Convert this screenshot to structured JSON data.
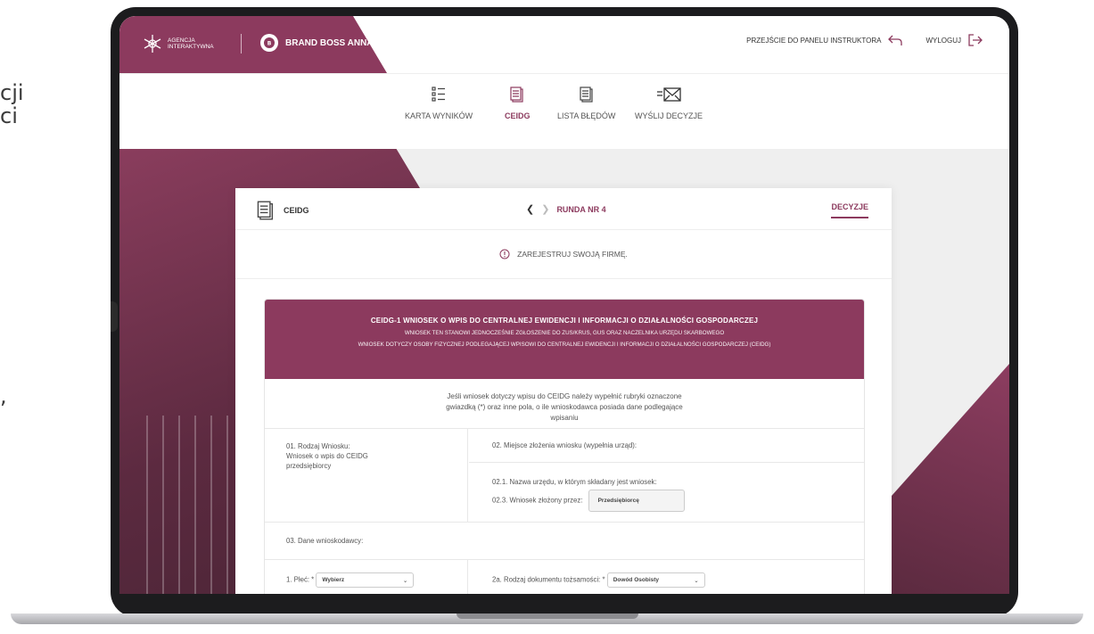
{
  "side_fragments": [
    "cji",
    "ci",
    ","
  ],
  "brand": {
    "agency_line1": "AGENCJA",
    "agency_line2": "INTERAKTYWNA",
    "company": "BRAND BOSS ANNA"
  },
  "header": {
    "instructor_link": "PRZEJŚCIE DO PANELU INSTRUKTORA",
    "logout": "WYLOGUJ"
  },
  "nav": {
    "items": [
      {
        "label": "KARTA WYNIKÓW",
        "icon": "list-icon"
      },
      {
        "label": "CEIDG",
        "icon": "document-icon",
        "active": true
      },
      {
        "label": "LISTA BŁĘDÓW",
        "icon": "documents-icon"
      },
      {
        "label": "WYŚLIJ DECYZJE",
        "icon": "envelope-icon"
      }
    ]
  },
  "card": {
    "title": "CEIDG",
    "round": "RUNDA NR 4",
    "decisions_tab": "DECYZJE",
    "notice": "ZAREJESTRUJ SWOJĄ FIRMĘ."
  },
  "form": {
    "title": "CEIDG-1 WNIOSEK O WPIS DO CENTRALNEJ EWIDENCJI I INFORMACJI O DZIAŁALNOŚCI GOSPODARCZEJ",
    "subtitle1": "WNIOSEK TEN STANOWI JEDNOCZEŚNIE ZGŁOSZENIE DO ZUS/KRUS, GUS ORAZ NACZELNIKA URZĘDU SKARBOWEGO",
    "subtitle2": "WNIOSEK DOTYCZY OSOBY FIZYCZNEJ PODLEGAJĄCEJ WPISOWI DO CENTRALNEJ EWIDENCJI I INFORMACJI O DZIAŁALNOŚCI GOSPODARCZEJ (CEIDG)",
    "intro_line1": "Jeśli wniosek dotyczy wpisu do CEIDG należy wypełnić rubryki oznaczone",
    "intro_line2": "gwiazdką (*) oraz inne pola, o ile wnioskodawca posiada dane podlegające",
    "intro_line3": "wpisaniu",
    "field01_label": "01. Rodzaj Wniosku:",
    "field01_value_line1": "Wniosek o wpis do CEIDG",
    "field01_value_line2": "przedsiębiorcy",
    "field02_label": "02. Miejsce złożenia wniosku (wypełnia urząd):",
    "field021_label": "02.1. Nazwa urzędu, w którym składany jest wniosek:",
    "field023_label": "02.3. Wniosek złożony przez:",
    "field023_value": "Przedsiębiorcę",
    "field03_label": "03. Dane wnioskodawcy:",
    "gender_label": "1. Płeć: *",
    "gender_value": "Wybierz",
    "doc_label": "2a. Rodzaj dokumentu tożsamości: *",
    "doc_value": "Dowód Osobisty"
  },
  "colors": {
    "accent": "#8c3a5e"
  }
}
